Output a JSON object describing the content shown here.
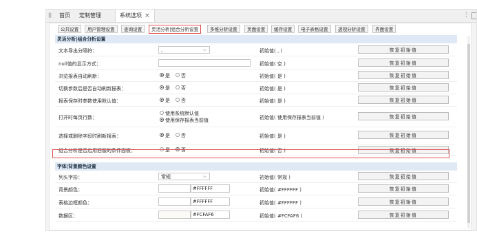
{
  "topbar": {
    "tabs": [
      {
        "label": "首页"
      },
      {
        "label": "定制管理"
      },
      {
        "label": "系统选项",
        "active": true
      }
    ],
    "close_icon": "×",
    "more_icon": "⋮"
  },
  "subtabs": [
    {
      "label": "公共设置"
    },
    {
      "label": "用户管理设置"
    },
    {
      "label": "查询设置"
    },
    {
      "label": "灵活分析|组合分析设置",
      "active": true
    },
    {
      "label": "多维分析设置"
    },
    {
      "label": "页面设置"
    },
    {
      "label": "缓存设置"
    },
    {
      "label": "电子表格设置"
    },
    {
      "label": "透视分析设置"
    },
    {
      "label": "界面设置"
    }
  ],
  "restore_label": "恢复初始值",
  "section1": {
    "title": "灵活分析|组合分析设置",
    "rows": [
      {
        "label": "文本导出分隔符：",
        "control": "select",
        "value": ",",
        "init": "初始值( , )"
      },
      {
        "label": "null值的显示方式：",
        "control": "text",
        "value": "",
        "init": "初始值( 空 )"
      },
      {
        "label": "浏览报表自动刷新：",
        "control": "radio",
        "options": [
          "是",
          "否"
        ],
        "selected": 0,
        "init": "初始值( 是 )"
      },
      {
        "label": "切换参数后是否自动刷新报表：",
        "control": "radio",
        "options": [
          "是",
          "否"
        ],
        "selected": 0,
        "init": "初始值( 是 )"
      },
      {
        "label": "报表保存时参数使用默认值：",
        "control": "radio",
        "options": [
          "是",
          "否"
        ],
        "selected": 0,
        "init": "初始值( 是 )"
      },
      {
        "label": "打开时每页行数：",
        "control": "radio2",
        "options": [
          "使用系统默认值",
          "使用保存报表当前值"
        ],
        "selected": 1,
        "init": "初始值( 使用保存报表当前值 )"
      },
      {
        "label": "选择或删除字段时刷新报表：",
        "control": "radio",
        "options": [
          "是",
          "否"
        ],
        "selected": 0,
        "init": "初始值( 是 )"
      },
      {
        "label": "组合分析是否启用旧版的条件面板：",
        "control": "radio",
        "options": [
          "是",
          "否"
        ],
        "selected": 1,
        "init": "初始值( 否 )"
      }
    ]
  },
  "section2": {
    "title": "字体|背景颜色设置",
    "rows": [
      {
        "label": "列头字形：",
        "control": "select",
        "value": "常规",
        "init": "初始值( 常规 )"
      },
      {
        "label": "背景颜色：",
        "control": "color",
        "swatch": "#FFFFFF",
        "value": "#FFFFFF",
        "init": "初始值( #FFFFFF )"
      },
      {
        "label": "表格边框颜色：",
        "control": "color",
        "swatch": "#FFFFFF",
        "value": "#FFFFFF",
        "init": "初始值( #FFFFFF )"
      },
      {
        "label": "数据区：",
        "control": "color",
        "swatch": "#FCFAF6",
        "value": "#FCFAF6",
        "init": "初始值( #FCFAF6 )"
      }
    ]
  },
  "colors": {
    "accent": "#e14a4a",
    "section_bg": "#dfe9f5"
  }
}
